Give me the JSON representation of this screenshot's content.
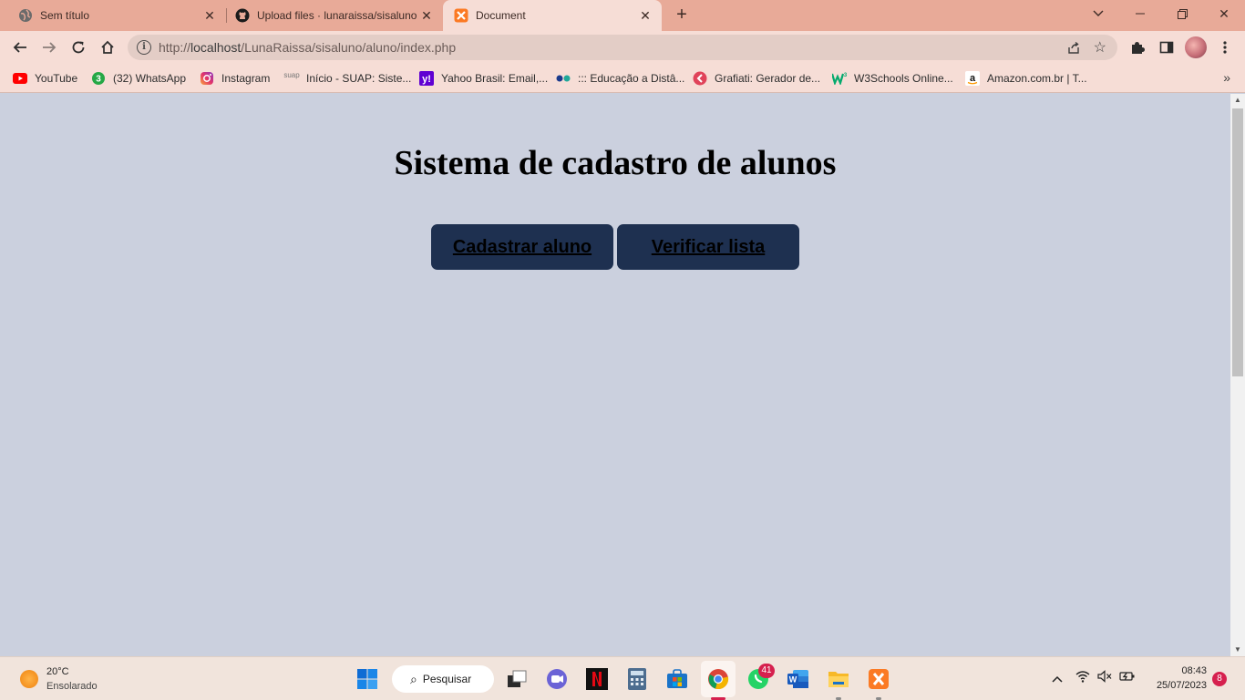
{
  "tabs": [
    {
      "title": "Sem título",
      "icon": "globe-icon"
    },
    {
      "title": "Upload files · lunaraissa/sisaluno",
      "icon": "github-icon"
    },
    {
      "title": "Document",
      "icon": "xampp-icon",
      "active": true
    }
  ],
  "address_bar": {
    "prefix": "http://",
    "host": "localhost",
    "path": "/LunaRaissa/sisaluno/aluno/index.php"
  },
  "bookmarks": [
    {
      "label": "YouTube",
      "icon": "youtube-icon"
    },
    {
      "label": "(32) WhatsApp",
      "icon": "whatsapp-icon"
    },
    {
      "label": "Instagram",
      "icon": "instagram-icon"
    },
    {
      "label": "Início - SUAP: Siste...",
      "icon": "suap-icon"
    },
    {
      "label": "Yahoo Brasil: Email,...",
      "icon": "yahoo-icon"
    },
    {
      "label": "::: Educação a Distâ...",
      "icon": "ead-icon"
    },
    {
      "label": "Grafiati: Gerador de...",
      "icon": "grafiati-icon"
    },
    {
      "label": "W3Schools Online...",
      "icon": "w3schools-icon"
    },
    {
      "label": "Amazon.com.br | T...",
      "icon": "amazon-icon"
    }
  ],
  "page": {
    "title": "Sistema de cadastro de alunos",
    "buttons": [
      {
        "label": "Cadastrar aluno"
      },
      {
        "label": "Verificar lista"
      }
    ],
    "background": "#cbd0de",
    "button_color": "#1e3050"
  },
  "taskbar": {
    "weather": {
      "temp": "20°C",
      "desc": "Ensolarado"
    },
    "search_label": "Pesquisar",
    "whatsapp_badge": "41",
    "clock": {
      "time": "08:43",
      "date": "25/07/2023"
    },
    "notifications": "8",
    "suap_text": "suap"
  }
}
